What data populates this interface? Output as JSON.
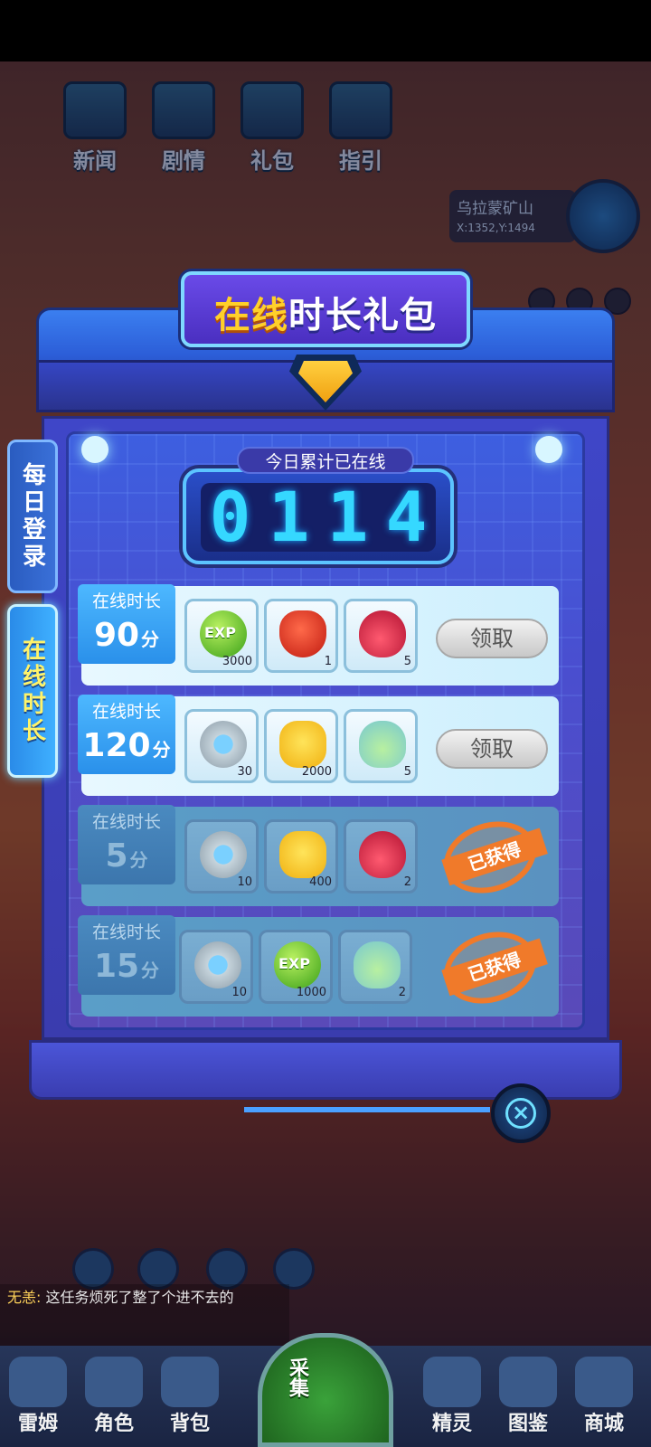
{
  "hud": {
    "top_buttons": [
      "新闻",
      "剧情",
      "礼包",
      "指引"
    ],
    "location": {
      "name": "乌拉蒙矿山",
      "coords": "X:1352,Y:1494"
    },
    "chat": {
      "speaker": "无恙:",
      "message": "这任务烦死了整了个进不去的"
    },
    "bottom_nav": [
      "雷姆",
      "角色",
      "背包",
      "精灵",
      "图鉴",
      "商城"
    ],
    "gather_label": "采集"
  },
  "modal": {
    "title_yellow": "在线",
    "title_white": "时长礼包",
    "tabs": [
      {
        "label": "每日登录",
        "active": false
      },
      {
        "label": "在线时长",
        "active": true
      }
    ],
    "timer": {
      "label": "今日累计已在线",
      "digits": [
        "0",
        "1",
        "1",
        "4"
      ]
    },
    "rows": [
      {
        "tag": "在线时长",
        "minutes": "90",
        "unit": "分",
        "status": "claimable",
        "action": "领取",
        "items": [
          {
            "icon": "exp-orb-icon",
            "qty": "3000"
          },
          {
            "icon": "rose-icon",
            "qty": "1"
          },
          {
            "icon": "red-potion-icon",
            "qty": "5"
          }
        ]
      },
      {
        "tag": "在线时长",
        "minutes": "120",
        "unit": "分",
        "status": "claimable",
        "action": "领取",
        "items": [
          {
            "icon": "energy-gear-icon",
            "qty": "30"
          },
          {
            "icon": "cat-coin-icon",
            "qty": "2000"
          },
          {
            "icon": "p-potion-icon",
            "qty": "5"
          }
        ]
      },
      {
        "tag": "在线时长",
        "minutes": "5",
        "unit": "分",
        "status": "claimed",
        "action": "已获得",
        "items": [
          {
            "icon": "energy-gear-icon",
            "qty": "10"
          },
          {
            "icon": "cat-coin-icon",
            "qty": "400"
          },
          {
            "icon": "red-potion-icon",
            "qty": "2"
          }
        ]
      },
      {
        "tag": "在线时长",
        "minutes": "15",
        "unit": "分",
        "status": "claimed",
        "action": "已获得",
        "items": [
          {
            "icon": "energy-gear-icon",
            "qty": "10"
          },
          {
            "icon": "exp-orb-icon",
            "qty": "1000"
          },
          {
            "icon": "p-potion-icon",
            "qty": "2"
          }
        ]
      }
    ]
  }
}
